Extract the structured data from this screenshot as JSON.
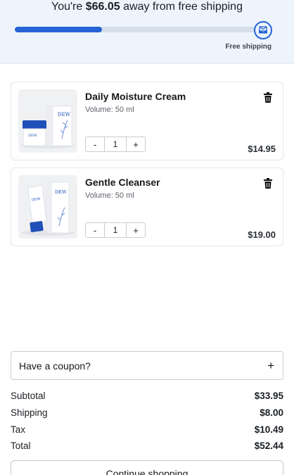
{
  "shipping_banner": {
    "message_prefix": "You're ",
    "amount_away": "$66.05",
    "message_suffix": " away from free shipping",
    "progress_fraction": 0.36,
    "goal_label": "Free shipping",
    "goal_icon": "envelope-icon"
  },
  "cart": {
    "items": [
      {
        "name": "Daily Moisture Cream",
        "variant": "Volume: 50 ml",
        "quantity": "1",
        "price": "$14.95",
        "decrement_label": "-",
        "increment_label": "+",
        "remove_icon": "trash-icon",
        "thumbnail": "jar-and-box-image",
        "brand_mark": "DEW"
      },
      {
        "name": "Gentle Cleanser",
        "variant": "Volume: 50 ml",
        "quantity": "1",
        "price": "$19.00",
        "decrement_label": "-",
        "increment_label": "+",
        "remove_icon": "trash-icon",
        "thumbnail": "tube-and-box-image",
        "brand_mark": "DEW"
      }
    ]
  },
  "coupon": {
    "label": "Have a coupon?",
    "expand_label": "+"
  },
  "summary": [
    {
      "label": "Subtotal",
      "value": "$33.95"
    },
    {
      "label": "Shipping",
      "value": "$8.00"
    },
    {
      "label": "Tax",
      "value": "$10.49"
    },
    {
      "label": "Total",
      "value": "$52.44"
    }
  ],
  "continue_label": "Continue shopping",
  "colors": {
    "accent": "#2563d6",
    "banner_bg": "#eef4fc",
    "track": "#d6deea",
    "product_blue": "#1f4fb8"
  }
}
